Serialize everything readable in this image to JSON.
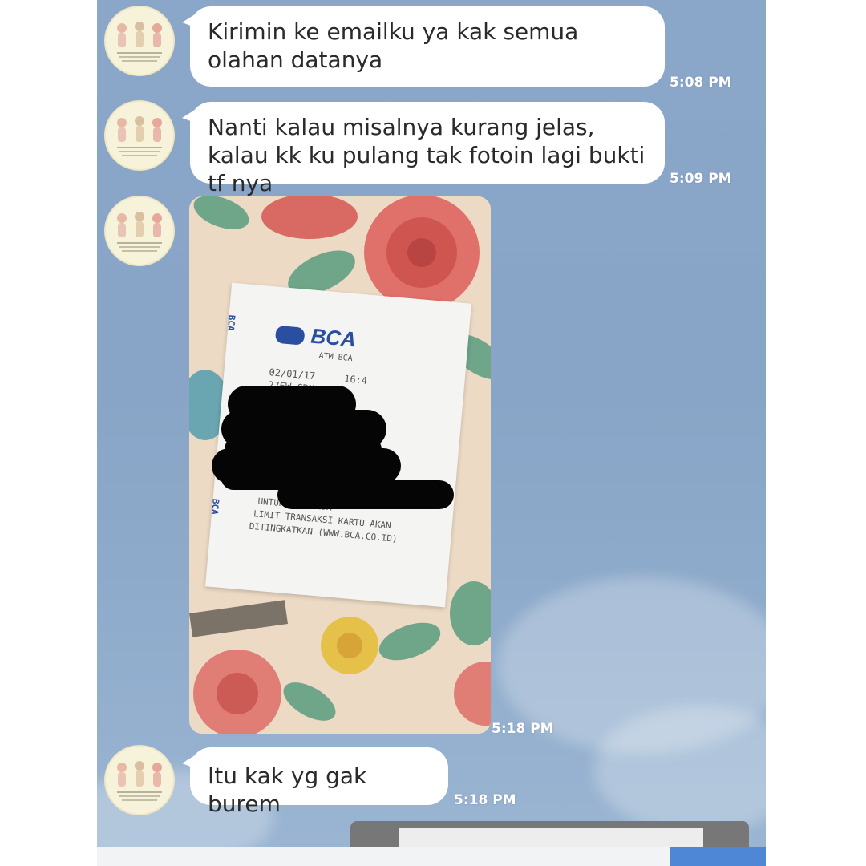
{
  "messages": [
    {
      "type": "text",
      "text": "Kirimin ke emailku ya kak semua olahan datanya",
      "time": "5:08 PM"
    },
    {
      "type": "text",
      "text": "Nanti kalau misalnya kurang jelas, kalau kk ku pulang tak fotoin lagi bukti tf nya",
      "time": "5:09 PM"
    },
    {
      "type": "image",
      "time": "5:18 PM",
      "receipt": {
        "bank": "BCA",
        "atm": "ATM BCA",
        "date": "02/01/17",
        "time_partial": "16:4",
        "code_partial": "276W-CRN",
        "side_logo": "BCA",
        "footer_lines": [
          "UNTUK ... ANDA",
          "LIMIT TRANSAKSI KARTU AKAN",
          "DITINGKATKAN (WWW.BCA.CO.ID)"
        ]
      }
    },
    {
      "type": "text",
      "text": "Itu kak yg gak burem",
      "time": "5:18 PM"
    }
  ],
  "colors": {
    "chat_bg": "#8aa6c9",
    "bubble": "#ffffff",
    "time_text": "#ffffff",
    "accent": "#4d87d6"
  },
  "icons": {
    "avatar": "avatar-illustration-icon"
  }
}
